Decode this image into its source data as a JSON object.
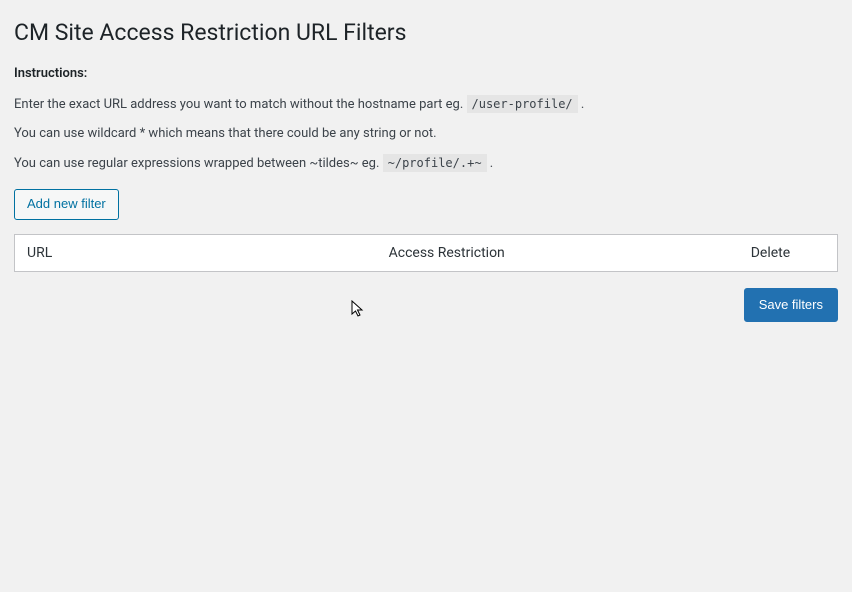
{
  "page": {
    "title": "CM Site Access Restriction URL Filters"
  },
  "instructions": {
    "label": "Instructions:",
    "line1_pre": "Enter the exact URL address you want to match without the hostname part eg. ",
    "line1_code": "/user-profile/",
    "line1_post": " .",
    "line2": "You can use wildcard * which means that there could be any string or not.",
    "line3_pre": "You can use regular expressions wrapped between ~tildes~ eg. ",
    "line3_code": "~/profile/.+~",
    "line3_post": " ."
  },
  "buttons": {
    "add_new_filter": "Add new filter",
    "save_filters": "Save filters"
  },
  "table": {
    "headers": {
      "url": "URL",
      "access_restriction": "Access Restriction",
      "delete": "Delete"
    },
    "rows": []
  }
}
